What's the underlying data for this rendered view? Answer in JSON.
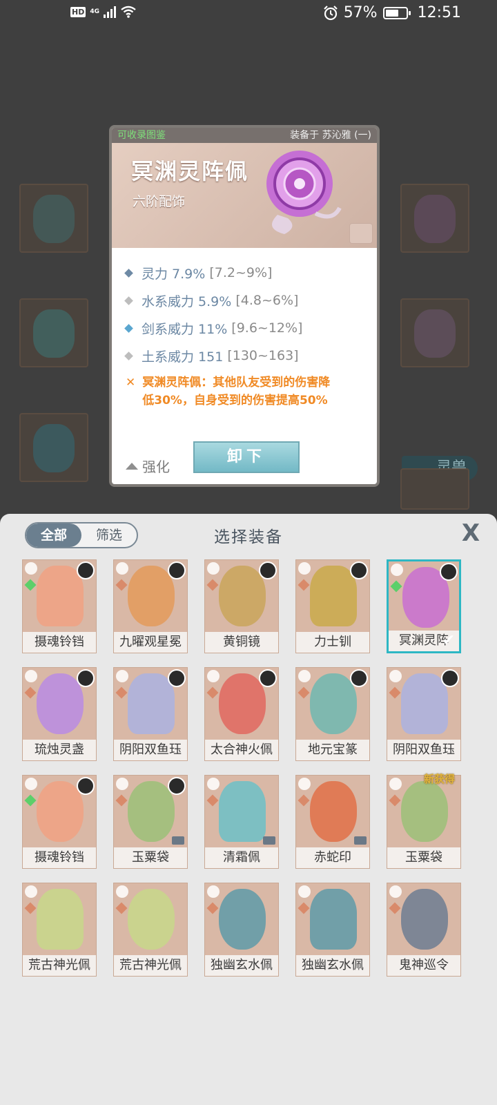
{
  "status_bar": {
    "hd": "HD",
    "net": "4G",
    "battery_pct": "57%",
    "time": "12:51",
    "icons": [
      "alarm-icon",
      "battery-saver-icon",
      "wifi-icon",
      "signal-icon"
    ]
  },
  "background": {
    "pet_button": "灵兽"
  },
  "detail": {
    "collect_label": "可收录图鉴",
    "equipped_on": "装备于 苏沁雅 (一)",
    "name": "冥渊灵阵佩",
    "tier": "六阶配饰",
    "stats": [
      {
        "label": "灵力 7.9%",
        "range": "[7.2~9%]",
        "color": "#6e8aa5"
      },
      {
        "label": "水系威力 5.9%",
        "range": "[4.8~6%]",
        "color": "#bdbdbd"
      },
      {
        "label": "剑系威力 11%",
        "range": "[9.6~12%]",
        "color": "#5aa6cf"
      },
      {
        "label": "土系威力 151",
        "range": "[130~163]",
        "color": "#bdbdbd"
      }
    ],
    "effect_line1": "冥渊灵阵佩：其他队友受到的伤害降",
    "effect_line2": "低30%，自身受到的伤害提高50%",
    "upgrade_label": "强化",
    "unequip_label": "卸下"
  },
  "panel": {
    "tab_all": "全部",
    "tab_filter": "筛选",
    "title": "选择装备",
    "close": "X",
    "new_badge": "新获得",
    "items": [
      {
        "name": "摄魂铃铛",
        "color": "#f0a183"
      },
      {
        "name": "九曜观星冕",
        "color": "#e39a5a"
      },
      {
        "name": "黄铜镜",
        "color": "#c9a45a"
      },
      {
        "name": "力士钏",
        "color": "#c9a94a"
      },
      {
        "name": "冥渊灵阵",
        "color": "#c86fd1"
      },
      {
        "name": "琉烛灵盏",
        "color": "#b98be3"
      },
      {
        "name": "阴阳双鱼珏",
        "color": "#aab2e0"
      },
      {
        "name": "太合神火佩",
        "color": "#e0675f"
      },
      {
        "name": "地元宝篆",
        "color": "#6fb7b0"
      },
      {
        "name": "阴阳双鱼珏",
        "color": "#aab2e0"
      },
      {
        "name": "摄魂铃铛",
        "color": "#f0a183"
      },
      {
        "name": "玉粟袋",
        "color": "#9bbf78"
      },
      {
        "name": "清霜佩",
        "color": "#6cc0c7"
      },
      {
        "name": "赤蛇印",
        "color": "#e07048"
      },
      {
        "name": "玉粟袋",
        "color": "#9bbf78"
      },
      {
        "name": "荒古神光佩",
        "color": "#c7d78a"
      },
      {
        "name": "荒古神光佩",
        "color": "#c7d78a"
      },
      {
        "name": "独幽玄水佩",
        "color": "#5e9aa8"
      },
      {
        "name": "独幽玄水佩",
        "color": "#5e9aa8"
      },
      {
        "name": "鬼神巡令",
        "color": "#6d7c92"
      }
    ]
  }
}
